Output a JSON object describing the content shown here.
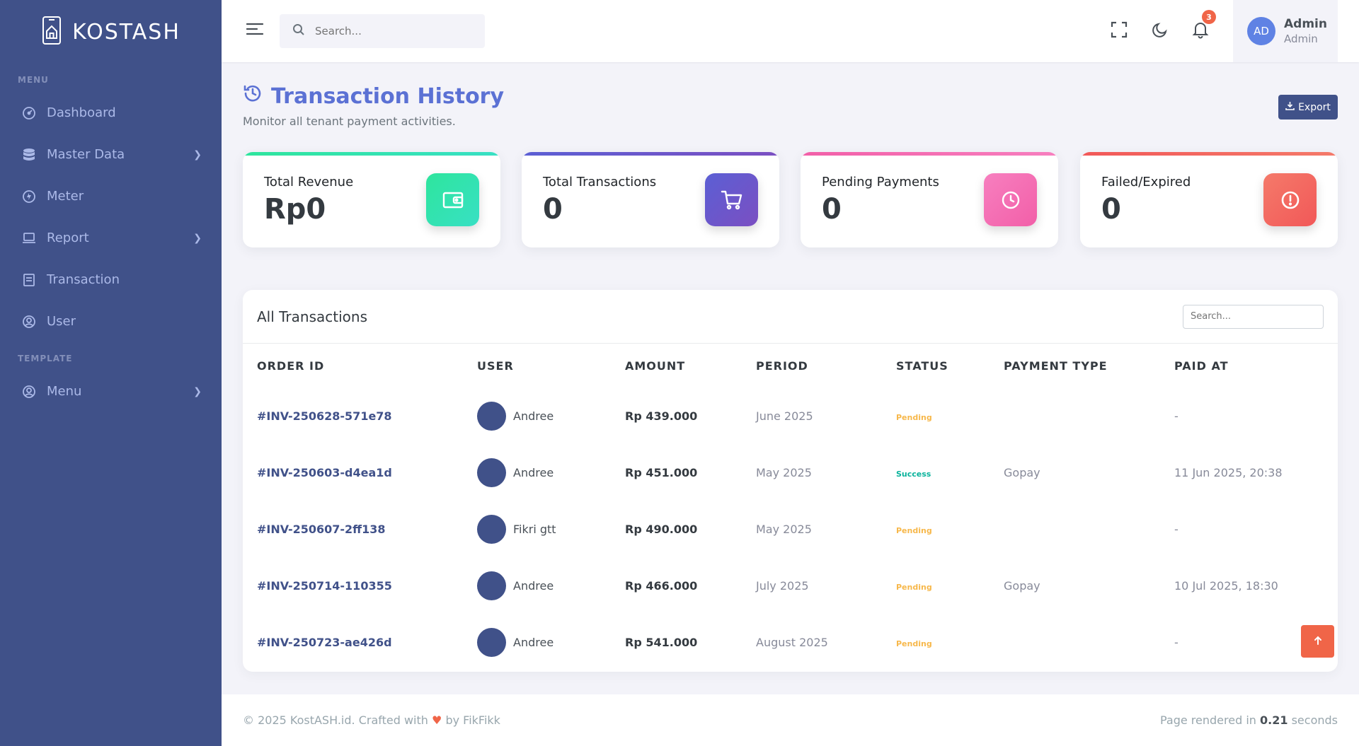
{
  "brand": {
    "name": "KOSTASH"
  },
  "sidebar": {
    "sections": [
      {
        "title": "MENU"
      },
      {
        "title": "TEMPLATE"
      }
    ],
    "items": [
      {
        "label": "Dashboard",
        "icon": "dashboard-icon"
      },
      {
        "label": "Master Data",
        "icon": "database-icon"
      },
      {
        "label": "Meter",
        "icon": "meter-icon"
      },
      {
        "label": "Report",
        "icon": "laptop-icon"
      },
      {
        "label": "Transaction",
        "icon": "receipt-icon"
      },
      {
        "label": "User",
        "icon": "user-circle-icon"
      },
      {
        "label": "Menu",
        "icon": "user-circle-icon"
      }
    ]
  },
  "topbar": {
    "search_placeholder": "Search...",
    "notification_count": "3",
    "user": {
      "initials": "AD",
      "name": "Admin",
      "role": "Admin"
    }
  },
  "page": {
    "title": "Transaction History",
    "subtitle": "Monitor all tenant payment activities.",
    "export_label": "Export"
  },
  "stats": [
    {
      "label": "Total Revenue",
      "value": "Rp0",
      "icon": "wallet-icon",
      "color": "#2ee59d"
    },
    {
      "label": "Total Transactions",
      "value": "0",
      "icon": "cart-icon",
      "color": "#5b5fd4"
    },
    {
      "label": "Pending Payments",
      "value": "0",
      "icon": "clock-icon",
      "color": "#f25fa8"
    },
    {
      "label": "Failed/Expired",
      "value": "0",
      "icon": "alert-icon",
      "color": "#f25858"
    }
  ],
  "table": {
    "title": "All Transactions",
    "search_placeholder": "Search...",
    "columns": [
      "ORDER ID",
      "USER",
      "AMOUNT",
      "PERIOD",
      "STATUS",
      "PAYMENT TYPE",
      "PAID AT"
    ],
    "rows": [
      {
        "order_id": "#INV-250628-571e78",
        "user": "Andree",
        "amount": "Rp 439.000",
        "period": "June 2025",
        "status": "Pending",
        "payment_type": "",
        "paid_at": "-"
      },
      {
        "order_id": "#INV-250603-d4ea1d",
        "user": "Andree",
        "amount": "Rp 451.000",
        "period": "May 2025",
        "status": "Success",
        "payment_type": "Gopay",
        "paid_at": "11 Jun 2025, 20:38"
      },
      {
        "order_id": "#INV-250607-2ff138",
        "user": "Fikri gtt",
        "amount": "Rp 490.000",
        "period": "May 2025",
        "status": "Pending",
        "payment_type": "",
        "paid_at": "-"
      },
      {
        "order_id": "#INV-250714-110355",
        "user": "Andree",
        "amount": "Rp 466.000",
        "period": "July 2025",
        "status": "Pending",
        "payment_type": "Gopay",
        "paid_at": "10 Jul 2025, 18:30"
      },
      {
        "order_id": "#INV-250723-ae426d",
        "user": "Andree",
        "amount": "Rp 541.000",
        "period": "August 2025",
        "status": "Pending",
        "payment_type": "",
        "paid_at": "-"
      }
    ]
  },
  "status_colors": {
    "Pending": "#f7b84b",
    "Success": "#0ab39c"
  },
  "footer": {
    "left_prefix": "© 2025 KostASH.id. Crafted with",
    "left_suffix": "by FikFikk",
    "right_prefix": "Page rendered in",
    "right_time": "0.21",
    "right_suffix": "seconds"
  }
}
